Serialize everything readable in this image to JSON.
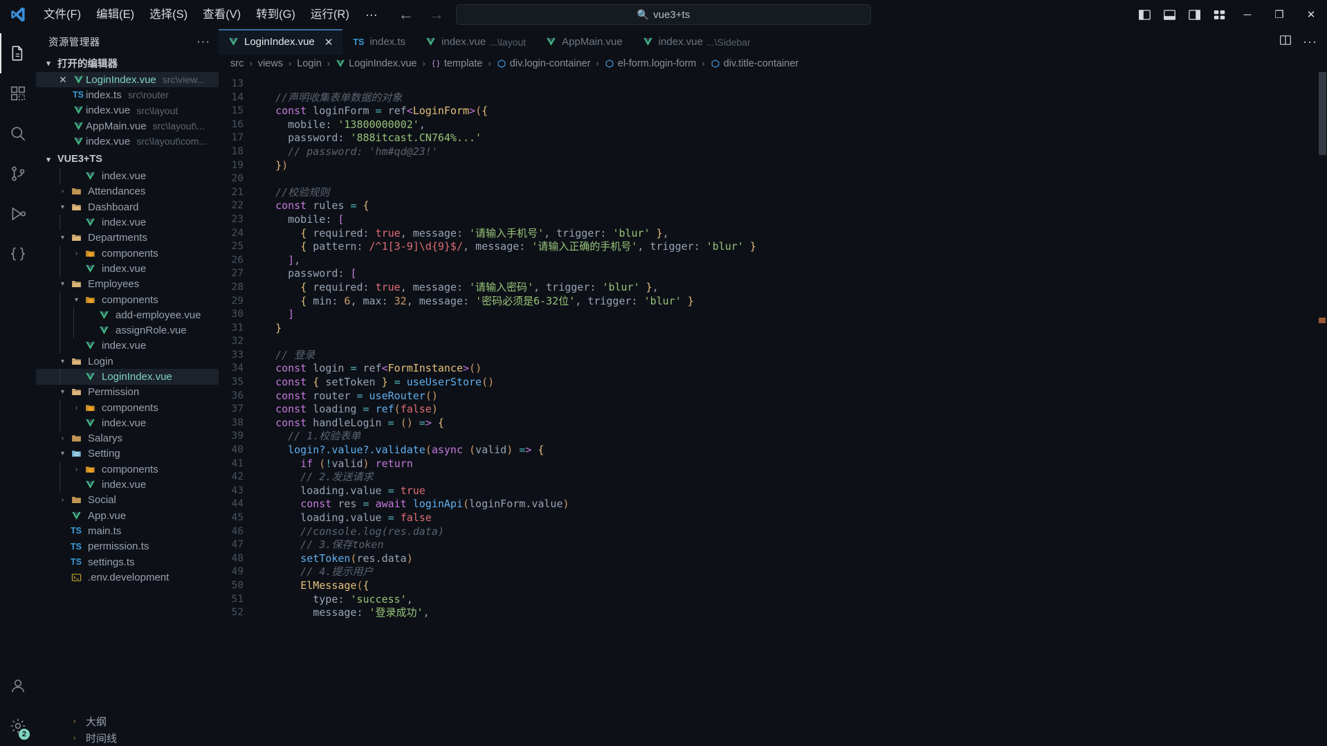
{
  "window": {
    "logo_icon": "vscode-logo",
    "menu": [
      "文件(F)",
      "编辑(E)",
      "选择(S)",
      "查看(V)",
      "转到(G)",
      "运行(R)"
    ],
    "menu_overflow": "···",
    "nav_back_icon": "arrow-left-icon",
    "nav_forward_icon": "arrow-right-icon",
    "command_center": {
      "icon": "search-icon",
      "text": "vue3+ts"
    },
    "layout_icons": [
      "toggle-primary-sidebar-icon",
      "toggle-panel-icon",
      "toggle-secondary-sidebar-icon",
      "customize-layout-icon"
    ],
    "controls": {
      "minimize": "─",
      "maximize": "❐",
      "close": "✕"
    }
  },
  "activitybar": {
    "items": [
      {
        "name": "explorer",
        "icon": "files-icon",
        "active": true
      },
      {
        "name": "extensions",
        "icon": "extensions-icon",
        "active": false
      },
      {
        "name": "search",
        "icon": "search-icon",
        "active": false
      },
      {
        "name": "source-control",
        "icon": "source-control-icon",
        "active": false
      },
      {
        "name": "run-and-debug",
        "icon": "run-debug-icon",
        "active": false
      },
      {
        "name": "json-outline",
        "icon": "braces-icon",
        "active": false
      }
    ],
    "bottom": [
      {
        "name": "accounts",
        "icon": "account-icon",
        "badge": ""
      },
      {
        "name": "settings",
        "icon": "gear-icon",
        "badge": "2"
      }
    ]
  },
  "sidebar": {
    "title": "资源管理器",
    "more_actions": "···",
    "open_editors": {
      "label": "打开的编辑器",
      "chevron": "▾",
      "items": [
        {
          "close": "✕",
          "icon": "vue-icon",
          "name": "LoginIndex.vue",
          "path": "src\\view...",
          "selected": true
        },
        {
          "close": "",
          "icon": "ts-icon",
          "name": "index.ts",
          "path": "src\\router",
          "selected": false
        },
        {
          "close": "",
          "icon": "vue-icon",
          "name": "index.vue",
          "path": "src\\layout",
          "selected": false
        },
        {
          "close": "",
          "icon": "vue-icon",
          "name": "AppMain.vue",
          "path": "src\\layout\\...",
          "selected": false
        },
        {
          "close": "",
          "icon": "vue-icon",
          "name": "index.vue",
          "path": "src\\layout\\com...",
          "selected": false
        }
      ]
    },
    "project": {
      "label": "VUE3+TS",
      "chevron": "▾",
      "tree": [
        {
          "depth": 2,
          "chevron": "",
          "icon": "vue-icon",
          "name": "index.vue",
          "selected": false
        },
        {
          "depth": 1,
          "chevron": "›",
          "icon": "folder-icon",
          "name": "Attendances",
          "selected": false
        },
        {
          "depth": 1,
          "chevron": "▾",
          "icon": "folder-open-icon",
          "name": "Dashboard",
          "selected": false
        },
        {
          "depth": 2,
          "chevron": "",
          "icon": "vue-icon",
          "name": "index.vue",
          "selected": false
        },
        {
          "depth": 1,
          "chevron": "▾",
          "icon": "folder-open-icon",
          "name": "Departments",
          "selected": false
        },
        {
          "depth": 2,
          "chevron": "›",
          "icon": "folder-comp-icon",
          "name": "components",
          "selected": false
        },
        {
          "depth": 2,
          "chevron": "",
          "icon": "vue-icon",
          "name": "index.vue",
          "selected": false
        },
        {
          "depth": 1,
          "chevron": "▾",
          "icon": "folder-open-icon",
          "name": "Employees",
          "selected": false
        },
        {
          "depth": 2,
          "chevron": "▾",
          "icon": "folder-comp-icon",
          "name": "components",
          "selected": false
        },
        {
          "depth": 3,
          "chevron": "",
          "icon": "vue-icon",
          "name": "add-employee.vue",
          "selected": false
        },
        {
          "depth": 3,
          "chevron": "",
          "icon": "vue-icon",
          "name": "assignRole.vue",
          "selected": false
        },
        {
          "depth": 2,
          "chevron": "",
          "icon": "vue-icon",
          "name": "index.vue",
          "selected": false
        },
        {
          "depth": 1,
          "chevron": "▾",
          "icon": "folder-open-icon",
          "name": "Login",
          "selected": false
        },
        {
          "depth": 2,
          "chevron": "",
          "icon": "vue-icon",
          "name": "LoginIndex.vue",
          "selected": true
        },
        {
          "depth": 1,
          "chevron": "▾",
          "icon": "folder-open-icon",
          "name": "Permission",
          "selected": false
        },
        {
          "depth": 2,
          "chevron": "›",
          "icon": "folder-comp-icon",
          "name": "components",
          "selected": false
        },
        {
          "depth": 2,
          "chevron": "",
          "icon": "vue-icon",
          "name": "index.vue",
          "selected": false
        },
        {
          "depth": 1,
          "chevron": "›",
          "icon": "folder-icon",
          "name": "Salarys",
          "selected": false
        },
        {
          "depth": 1,
          "chevron": "▾",
          "icon": "folder-setting-icon",
          "name": "Setting",
          "selected": false
        },
        {
          "depth": 2,
          "chevron": "›",
          "icon": "folder-comp-icon",
          "name": "components",
          "selected": false
        },
        {
          "depth": 2,
          "chevron": "",
          "icon": "vue-icon",
          "name": "index.vue",
          "selected": false
        },
        {
          "depth": 1,
          "chevron": "›",
          "icon": "folder-icon",
          "name": "Social",
          "selected": false
        },
        {
          "depth": 1,
          "chevron": "",
          "icon": "vue-icon",
          "name": "App.vue",
          "selected": false
        },
        {
          "depth": 1,
          "chevron": "",
          "icon": "ts-icon",
          "name": "main.ts",
          "selected": false
        },
        {
          "depth": 1,
          "chevron": "",
          "icon": "ts-icon",
          "name": "permission.ts",
          "selected": false
        },
        {
          "depth": 1,
          "chevron": "",
          "icon": "ts-icon",
          "name": "settings.ts",
          "selected": false
        },
        {
          "depth": 1,
          "chevron": "",
          "icon": "env-icon",
          "name": ".env.development",
          "selected": false
        }
      ]
    },
    "bottom_sections": [
      {
        "chevron": "›",
        "label": "大纲"
      },
      {
        "chevron": "›",
        "label": "时间线"
      }
    ]
  },
  "editor": {
    "tabs": [
      {
        "icon": "vue-icon",
        "label": "LoginIndex.vue",
        "path": "",
        "active": true,
        "close": "✕"
      },
      {
        "icon": "ts-icon",
        "label": "index.ts",
        "path": "",
        "active": false,
        "close": ""
      },
      {
        "icon": "vue-icon",
        "label": "index.vue",
        "path": "...\\layout",
        "active": false,
        "close": ""
      },
      {
        "icon": "vue-icon",
        "label": "AppMain.vue",
        "path": "",
        "active": false,
        "close": ""
      },
      {
        "icon": "vue-icon",
        "label": "index.vue",
        "path": "...\\Sidebar",
        "active": false,
        "close": ""
      }
    ],
    "tabbar_actions": {
      "split_icon": "split-editor-icon",
      "more": "···"
    },
    "breadcrumb": [
      {
        "icon": "",
        "label": "src"
      },
      {
        "icon": "",
        "label": "views"
      },
      {
        "icon": "",
        "label": "Login"
      },
      {
        "icon": "vue-icon",
        "label": "LoginIndex.vue"
      },
      {
        "icon": "braces-icon",
        "label": "template"
      },
      {
        "icon": "symbol-field-icon",
        "label": "div.login-container"
      },
      {
        "icon": "symbol-field-icon",
        "label": "el-form.login-form"
      },
      {
        "icon": "symbol-field-icon",
        "label": "div.title-container"
      }
    ],
    "breadcrumb_separator": "›",
    "first_line_number": 13,
    "code_lines": [
      {
        "n": 13,
        "text": ""
      },
      {
        "n": 14,
        "text": "  //声明收集表单数据的对象"
      },
      {
        "n": 15,
        "text": "  const loginForm = ref<LoginForm>({"
      },
      {
        "n": 16,
        "text": "    mobile: '13800000002',"
      },
      {
        "n": 17,
        "text": "    password: '888itcast.CN764%...'"
      },
      {
        "n": 18,
        "text": "    // password: 'hm#qd@23!'"
      },
      {
        "n": 19,
        "text": "  })"
      },
      {
        "n": 20,
        "text": ""
      },
      {
        "n": 21,
        "text": "  //校验规则"
      },
      {
        "n": 22,
        "text": "  const rules = {"
      },
      {
        "n": 23,
        "text": "    mobile: ["
      },
      {
        "n": 24,
        "text": "      { required: true, message: '请输入手机号', trigger: 'blur' },"
      },
      {
        "n": 25,
        "text": "      { pattern: /^1[3-9]\\d{9}$/, message: '请输入正确的手机号', trigger: 'blur' }"
      },
      {
        "n": 26,
        "text": "    ],"
      },
      {
        "n": 27,
        "text": "    password: ["
      },
      {
        "n": 28,
        "text": "      { required: true, message: '请输入密码', trigger: 'blur' },"
      },
      {
        "n": 29,
        "text": "      { min: 6, max: 32, message: '密码必须是6-32位', trigger: 'blur' }"
      },
      {
        "n": 30,
        "text": "    ]"
      },
      {
        "n": 31,
        "text": "  }"
      },
      {
        "n": 32,
        "text": ""
      },
      {
        "n": 33,
        "text": "  // 登录"
      },
      {
        "n": 34,
        "text": "  const login = ref<FormInstance>()"
      },
      {
        "n": 35,
        "text": "  const { setToken } = useUserStore()"
      },
      {
        "n": 36,
        "text": "  const router = useRouter()"
      },
      {
        "n": 37,
        "text": "  const loading = ref(false)"
      },
      {
        "n": 38,
        "text": "  const handleLogin = () => {"
      },
      {
        "n": 39,
        "text": "    // 1.校验表单"
      },
      {
        "n": 40,
        "text": "    login?.value?.validate(async (valid) => {"
      },
      {
        "n": 41,
        "text": "      if (!valid) return"
      },
      {
        "n": 42,
        "text": "      // 2.发送请求"
      },
      {
        "n": 43,
        "text": "      loading.value = true"
      },
      {
        "n": 44,
        "text": "      const res = await loginApi(loginForm.value)"
      },
      {
        "n": 45,
        "text": "      loading.value = false"
      },
      {
        "n": 46,
        "text": "      //console.log(res.data)"
      },
      {
        "n": 47,
        "text": "      // 3.保存token"
      },
      {
        "n": 48,
        "text": "      setToken(res.data)"
      },
      {
        "n": 49,
        "text": "      // 4.提示用户"
      },
      {
        "n": 50,
        "text": "      ElMessage({"
      },
      {
        "n": 51,
        "text": "        type: 'success',"
      },
      {
        "n": 52,
        "text": "        message: '登录成功',"
      }
    ]
  },
  "colors": {
    "background": "#0d1117",
    "editor_bg": "#0d1117",
    "active_tab_bg": "#121821",
    "accent": "#3a6ea8",
    "vue_green": "#42b883",
    "ts_blue": "#3b9bd8",
    "selected_text": "#7fd4c1",
    "badge": "#7fd4c1"
  }
}
